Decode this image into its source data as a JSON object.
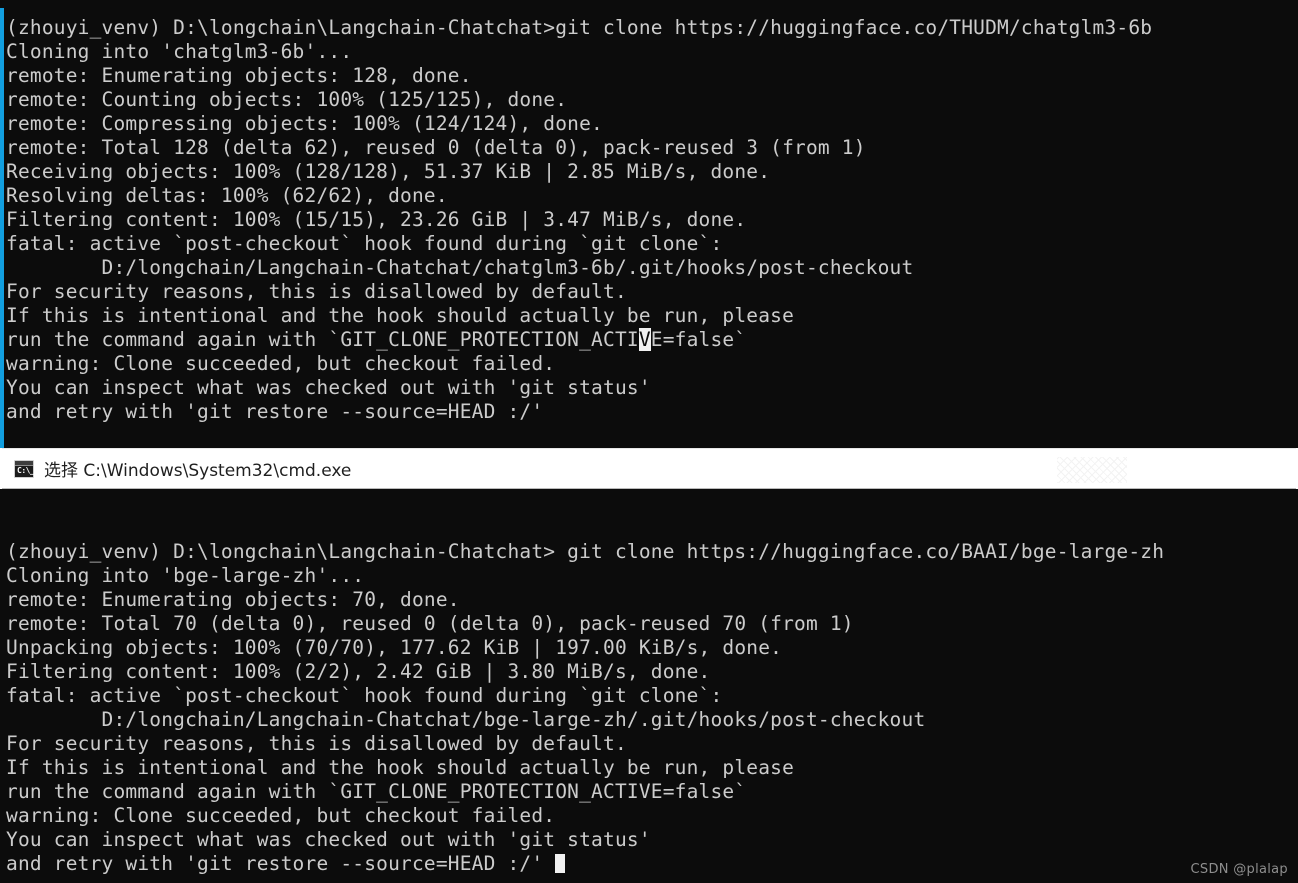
{
  "window": {
    "title_prefix": "选择",
    "title_path": "C:\\Windows\\System32\\cmd.exe",
    "title_full": "选择 C:\\Windows\\System32\\cmd.exe",
    "icon_name": "cmd-exe-icon",
    "icon_glyph": "C:\\_",
    "accent_color": "#129fe0",
    "background_color": "#0c0c0c",
    "foreground_color": "#cccccc"
  },
  "watermark": {
    "text": "CSDN @plalap",
    "color": "#8e8e8e"
  },
  "terminal_top": {
    "prompt_env": "(zhouyi_venv)",
    "prompt_path": "D:\\longchain\\Langchain-Chatchat>",
    "command": "git clone https://huggingface.co/THUDM/chatglm3-6b",
    "repo_url": "https://huggingface.co/THUDM/chatglm3-6b",
    "repo_name": "chatglm3-6b",
    "lines": [
      "(zhouyi_venv) D:\\longchain\\Langchain-Chatchat>git clone https://huggingface.co/THUDM/chatglm3-6b",
      "Cloning into 'chatglm3-6b'...",
      "remote: Enumerating objects: 128, done.",
      "remote: Counting objects: 100% (125/125), done.",
      "remote: Compressing objects: 100% (124/124), done.",
      "remote: Total 128 (delta 62), reused 0 (delta 0), pack-reused 3 (from 1)",
      "Receiving objects: 100% (128/128), 51.37 KiB | 2.85 MiB/s, done.",
      "Resolving deltas: 100% (62/62), done.",
      "Filtering content: 100% (15/15), 23.26 GiB | 3.47 MiB/s, done.",
      "fatal: active `post-checkout` hook found during `git clone`:",
      "        D:/longchain/Langchain-Chatchat/chatglm3-6b/.git/hooks/post-checkout",
      "For security reasons, this is disallowed by default.",
      "If this is intentional and the hook should actually be run, please",
      "run the command again with `GIT_CLONE_PROTECTION_ACTIVE=false`",
      "warning: Clone succeeded, but checkout failed.",
      "You can inspect what was checked out with 'git status'",
      "and retry with 'git restore --source=HEAD :/'"
    ],
    "selection_line_index": 13,
    "selection_before": "run the command again with `GIT_CLONE_PROTECTION_ACTI",
    "selection_text": "V",
    "selection_after": "E=false`"
  },
  "terminal_bottom": {
    "prompt_env": "(zhouyi_venv)",
    "prompt_path": "D:\\longchain\\Langchain-Chatchat>",
    "command": "git clone https://huggingface.co/BAAI/bge-large-zh",
    "repo_url": "https://huggingface.co/BAAI/bge-large-zh",
    "repo_name": "bge-large-zh",
    "lines": [
      "",
      "(zhouyi_venv) D:\\longchain\\Langchain-Chatchat> git clone https://huggingface.co/BAAI/bge-large-zh",
      "Cloning into 'bge-large-zh'...",
      "remote: Enumerating objects: 70, done.",
      "remote: Total 70 (delta 0), reused 0 (delta 0), pack-reused 70 (from 1)",
      "Unpacking objects: 100% (70/70), 177.62 KiB | 197.00 KiB/s, done.",
      "Filtering content: 100% (2/2), 2.42 GiB | 3.80 MiB/s, done.",
      "fatal: active `post-checkout` hook found during `git clone`:",
      "        D:/longchain/Langchain-Chatchat/bge-large-zh/.git/hooks/post-checkout",
      "For security reasons, this is disallowed by default.",
      "If this is intentional and the hook should actually be run, please",
      "run the command again with `GIT_CLONE_PROTECTION_ACTIVE=false`",
      "warning: Clone succeeded, but checkout failed.",
      "You can inspect what was checked out with 'git status'",
      "and retry with 'git restore --source=HEAD :/' "
    ],
    "cursor_line_index": 14,
    "cursor_visible": true
  }
}
